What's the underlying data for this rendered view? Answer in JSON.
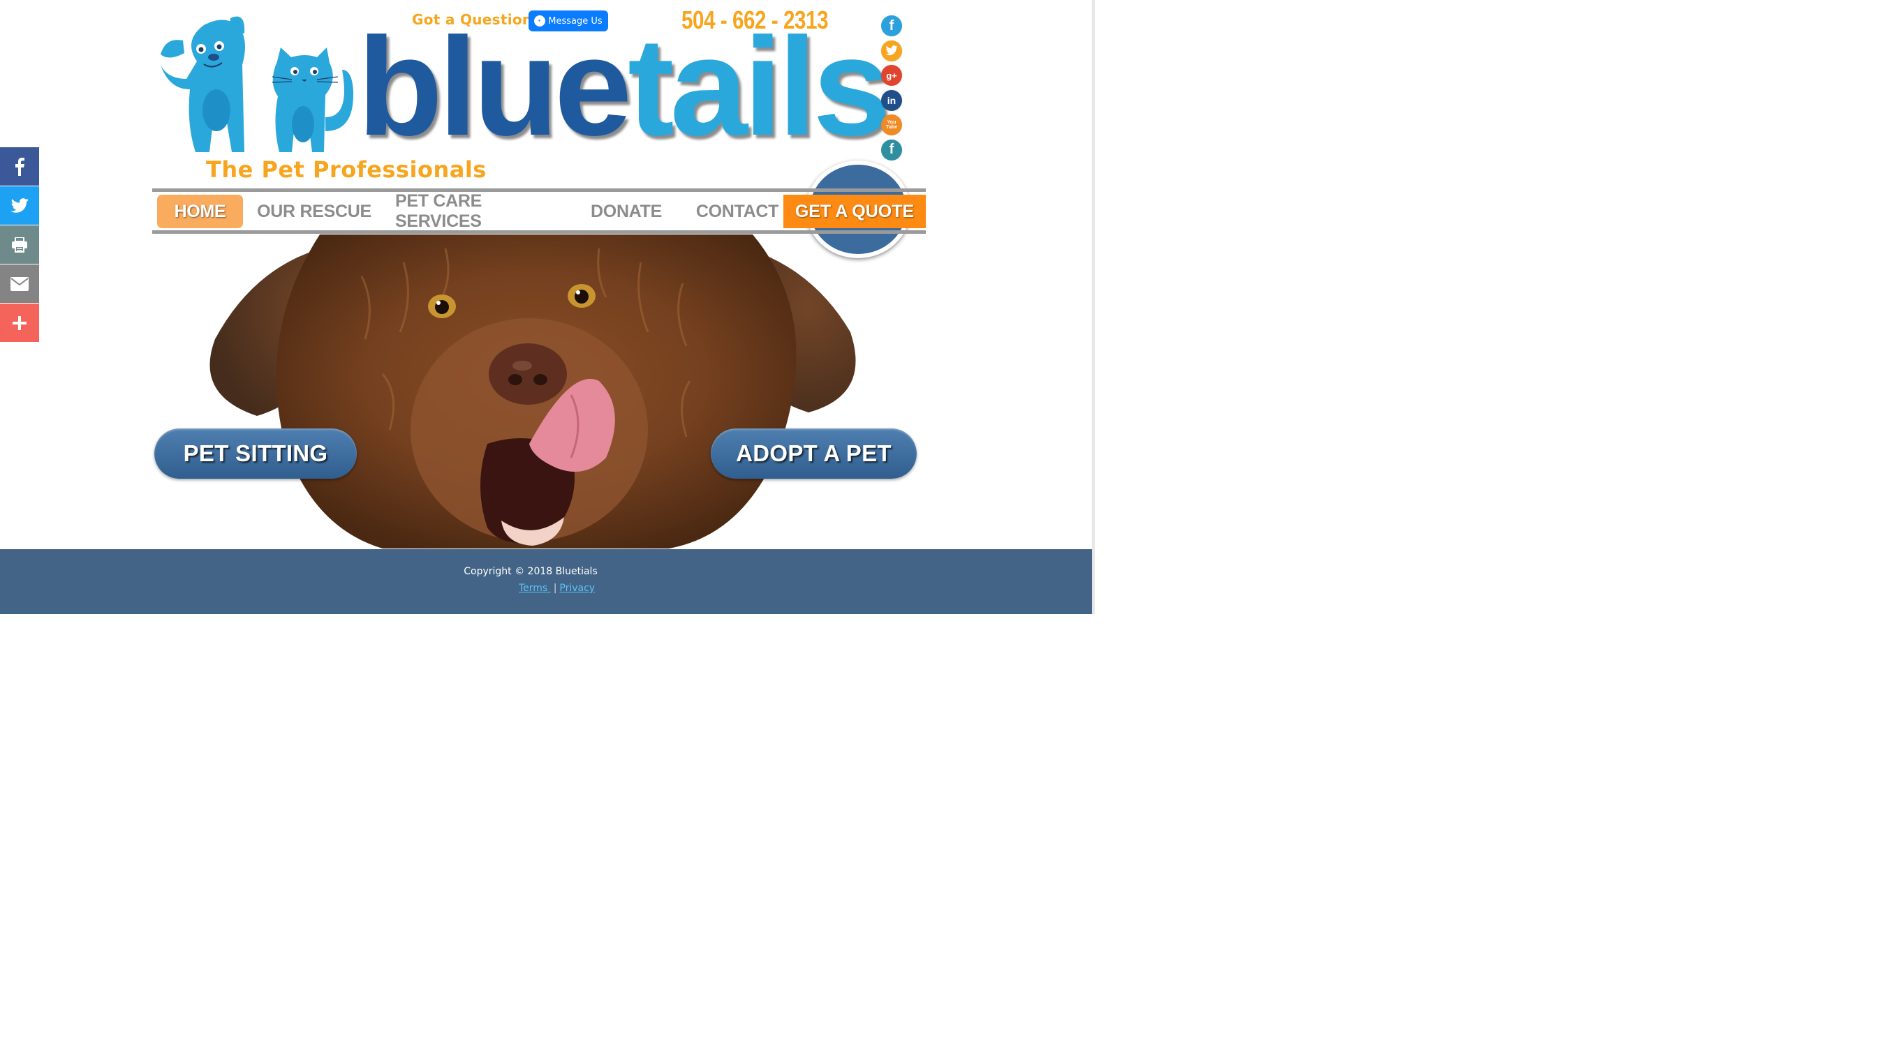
{
  "header": {
    "question_label": "Got a Question?",
    "message_button_label": "Message Us",
    "phone": "504 - 662 - 2313",
    "brand_word_1": "blue",
    "brand_word_2": "tails",
    "tagline": "The Pet Professionals"
  },
  "share_bar": {
    "items": [
      {
        "icon": "facebook-icon",
        "color": "#3b5998"
      },
      {
        "icon": "twitter-icon",
        "color": "#1da1f2"
      },
      {
        "icon": "print-icon",
        "color": "#6e8a8a"
      },
      {
        "icon": "email-icon",
        "color": "#848484"
      },
      {
        "icon": "plus-icon",
        "color": "#f4645a"
      }
    ]
  },
  "social": {
    "items": [
      {
        "icon": "facebook-icon",
        "glyph": "f",
        "color": "#2aa0dc"
      },
      {
        "icon": "twitter-icon",
        "glyph": "t",
        "color": "#f7a51e"
      },
      {
        "icon": "google-plus-icon",
        "glyph": "g+",
        "color": "#e0452f"
      },
      {
        "icon": "linkedin-icon",
        "glyph": "in",
        "color": "#1f4e8a"
      },
      {
        "icon": "youtube-icon",
        "glyph": "You Tube",
        "color": "#f08a24"
      },
      {
        "icon": "facebook-icon",
        "glyph": "f",
        "color": "#2e8fa0"
      }
    ]
  },
  "nav": {
    "items": [
      {
        "label": "HOME",
        "active": true
      },
      {
        "label": "OUR RESCUE"
      },
      {
        "label": "PET CARE SERVICES"
      },
      {
        "label": "DONATE"
      },
      {
        "label": "CONTACT"
      }
    ],
    "quote_label": "GET A QUOTE"
  },
  "hero": {
    "cta_left": "PET SITTING",
    "cta_right": "ADOPT A PET"
  },
  "footer": {
    "copyright": "Copyright © 2018 Bluetials",
    "terms": "Terms ",
    "separator": "|",
    "privacy": "Privacy"
  },
  "colors": {
    "accent_orange": "#f7a51e",
    "quote_orange": "#fd8a12",
    "brand_dark_blue": "#1f5a9e",
    "brand_light_blue": "#2aa8dc",
    "footer_blue": "#436487"
  }
}
